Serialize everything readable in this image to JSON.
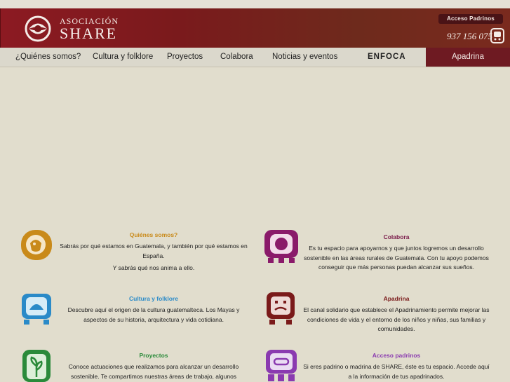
{
  "header": {
    "logo_top": "ASOCIACIÓN",
    "logo_main": "SHARE",
    "access_button": "Acceso Padrinos",
    "phone": "937 156 075"
  },
  "nav": {
    "items": [
      "¿Quiénes somos?",
      "Cultura y folklore",
      "Proyectos",
      "Colabora",
      "Noticias y eventos",
      "ENFOCA"
    ],
    "apadrina": "Apadrina"
  },
  "cards": {
    "quienes": {
      "title": "Quiénes somos?",
      "text1": "Sabrás por qué estamos en Guatemala, y también por qué estamos en España.",
      "text2": "Y sabrás qué nos anima a ello."
    },
    "colabora": {
      "title": "Colabora",
      "text": "Es tu espacio para apoyarnos y que juntos logremos un desarrollo sostenible en las áreas rurales de Guatemala. Con tu apoyo podemos conseguir que más personas puedan alcanzar sus sueños."
    },
    "cultura": {
      "title": "Cultura y folklore",
      "text": "Descubre aquí el origen de la cultura guatemalteca. Los Mayas y aspectos de su historia, arquitectura y vida cotidiana."
    },
    "apadrina": {
      "title": "Apadrina",
      "text": "El canal solidario que establece el Apadrinamiento permite mejorar las condiciones de vida y el entorno de los niños y niñas, sus familias y comunidades."
    },
    "proyectos": {
      "title": "Proyectos",
      "text": "Conoce actuaciones que realizamos para alcanzar un desarrollo sostenible. Te compartimos nuestras áreas de trabajo, algunos"
    },
    "acceso": {
      "title": "Acceso padrinos",
      "text": "Si eres padrino o madrina de SHARE, éste es tu espacio. Accede aquí a la información de tus apadrinados."
    }
  },
  "colors": {
    "header_red": "#7a1a1c",
    "quienes": "#c98a1a",
    "colabora": "#8a1a6a",
    "cultura": "#2a8ac8",
    "apadrina": "#7a1a1a",
    "proyectos": "#2a8a3a",
    "acceso": "#8a3ab0"
  }
}
